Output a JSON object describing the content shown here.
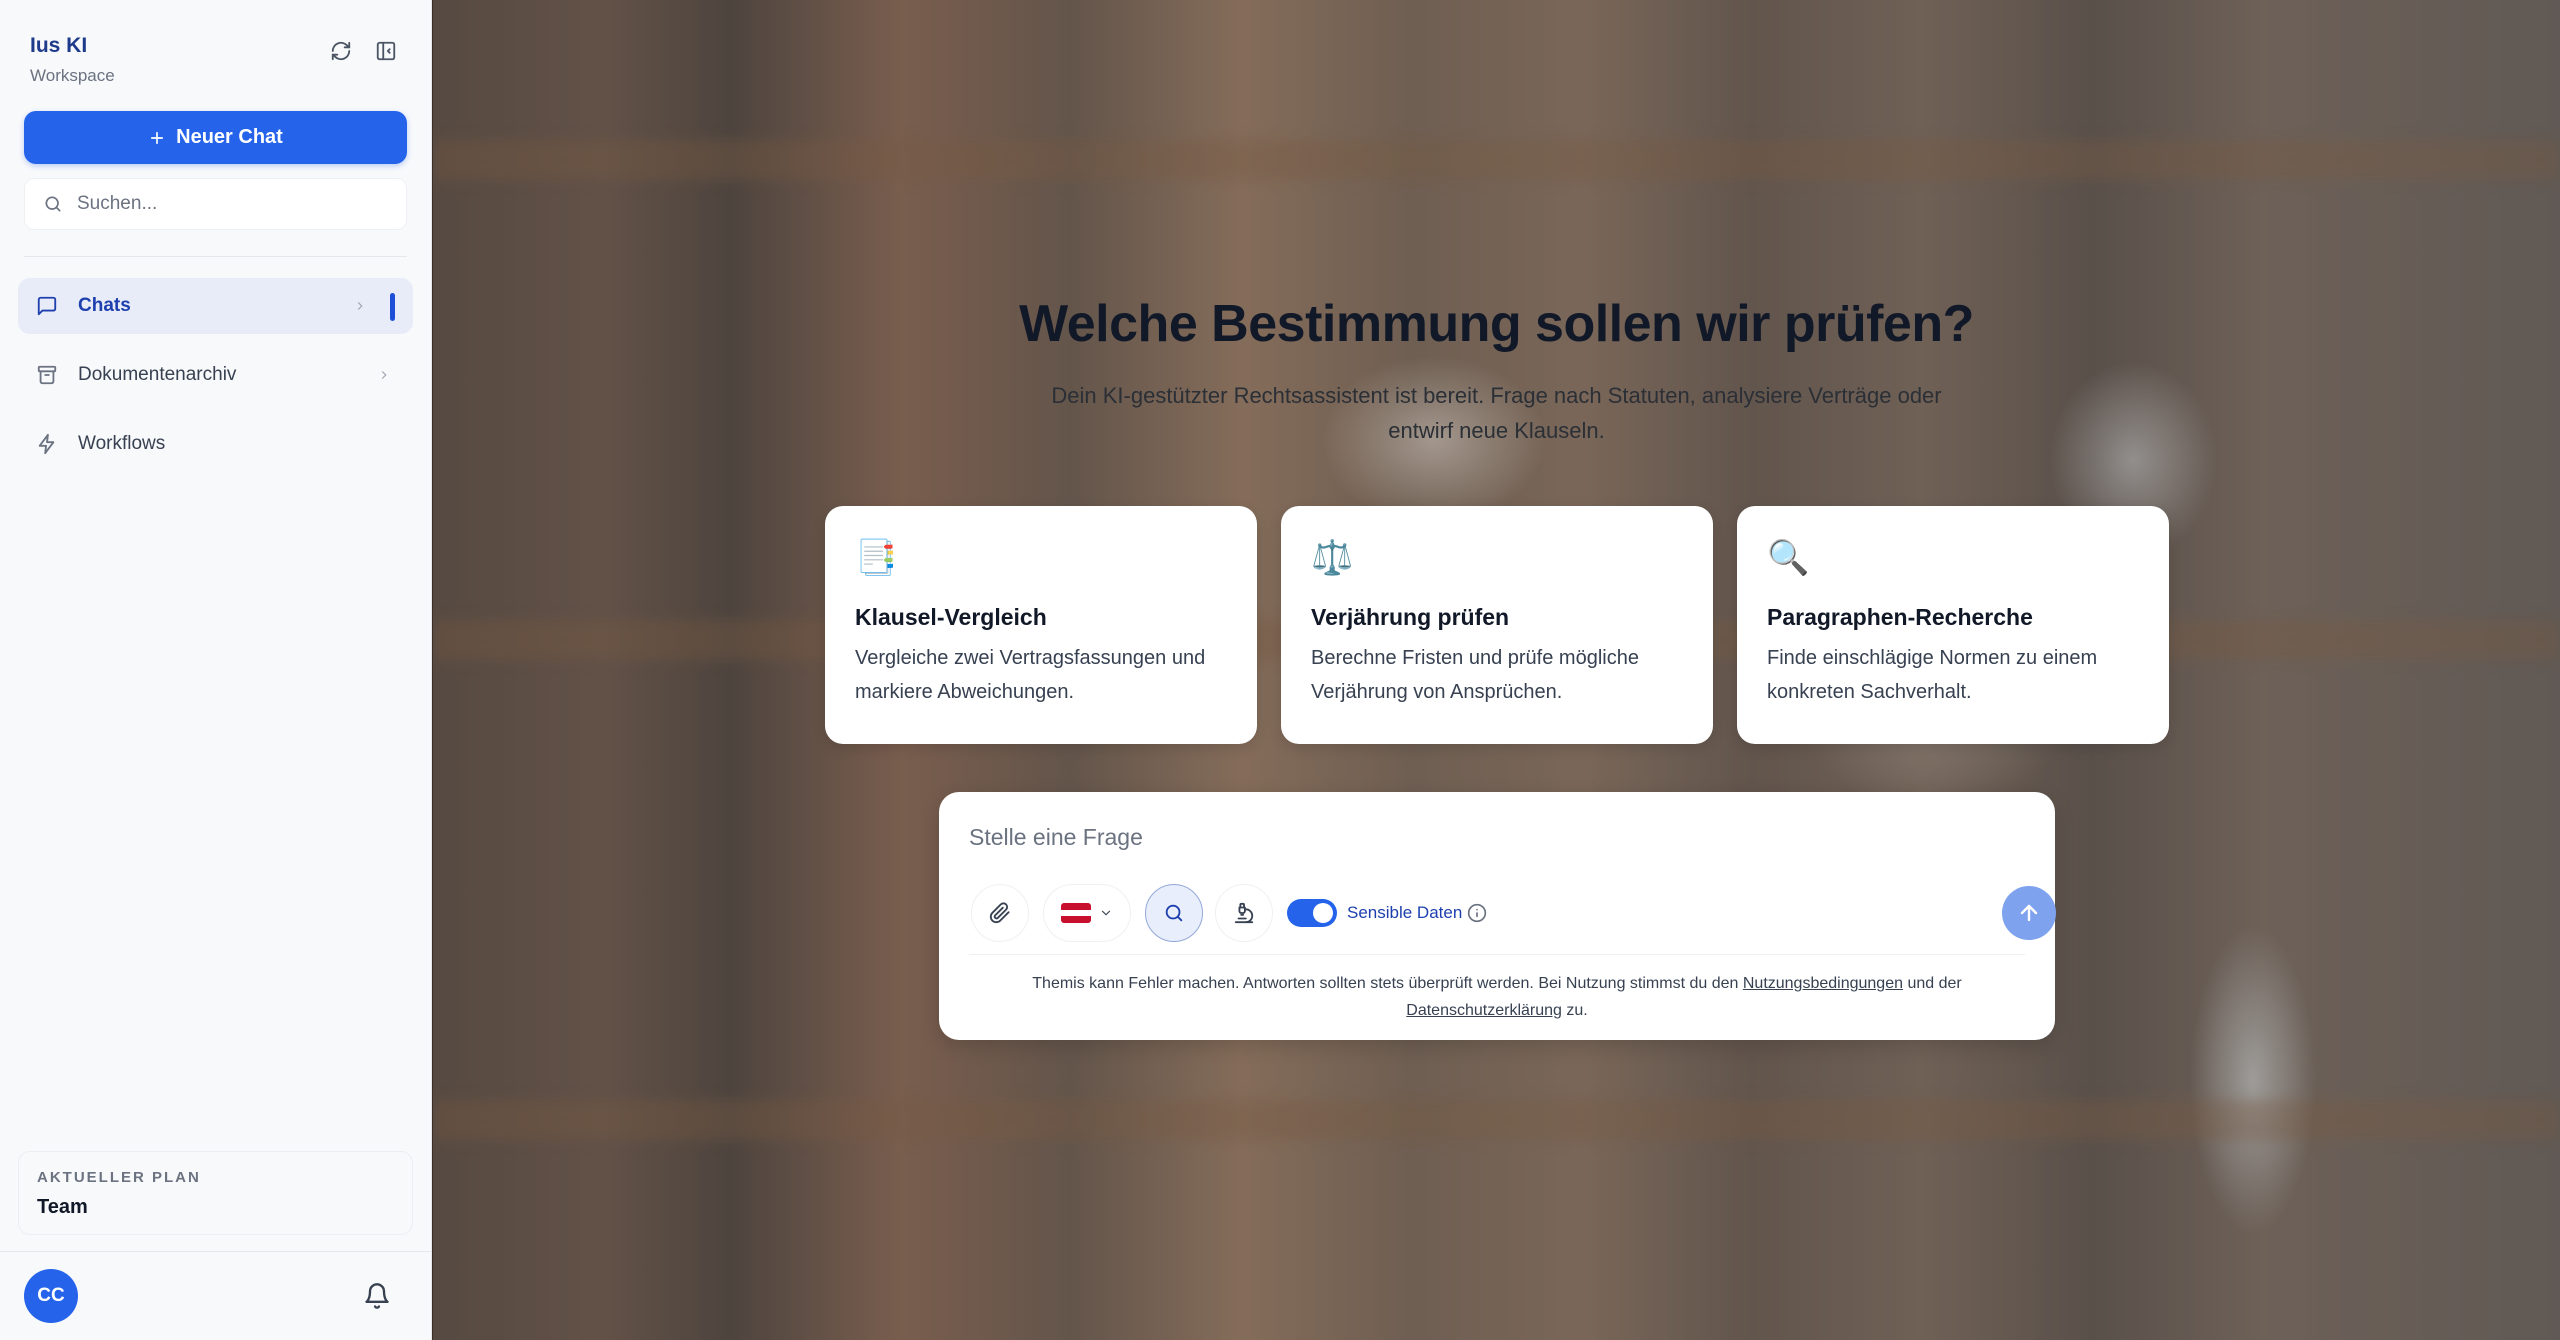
{
  "brand": {
    "title": "Ius KI",
    "subtitle": "Workspace"
  },
  "sidebar": {
    "new_chat_label": "Neuer Chat",
    "search_placeholder": "Suchen...",
    "items": [
      {
        "label": "Chats",
        "icon": "message-square-icon",
        "active": true
      },
      {
        "label": "Dokumentenarchiv",
        "icon": "archive-icon",
        "active": false
      },
      {
        "label": "Workflows",
        "icon": "lightning-icon",
        "active": false
      }
    ],
    "plan": {
      "label": "AKTUELLER PLAN",
      "name": "Team"
    },
    "avatar_initials": "CC"
  },
  "hero": {
    "title": "Welche Bestimmung sollen wir prüfen?",
    "subtitle": "Dein KI-gestützter Rechtsassistent ist bereit. Frage nach Statuten, analysiere Verträge oder entwirf neue Klauseln."
  },
  "cards": [
    {
      "emoji": "📑",
      "title": "Klausel-Vergleich",
      "desc": "Vergleiche zwei Vertragsfassungen und markiere Abweichungen."
    },
    {
      "emoji": "⚖️",
      "title": "Verjährung prüfen",
      "desc": "Berechne Fristen und prüfe mögliche Verjährung von Ansprüchen."
    },
    {
      "emoji": "🔍",
      "title": "Paragraphen-Recherche",
      "desc": "Finde einschlägige Normen zu einem konkreten Sachverhalt."
    }
  ],
  "composer": {
    "placeholder": "Stelle eine Frage",
    "sensitive_label": "Sensible Daten",
    "disclaimer_pre": "Themis kann Fehler machen. Antworten sollten stets überprüft werden. Bei Nutzung stimmst du den ",
    "terms_link": "Nutzungsbedingungen",
    "disclaimer_mid": " und der ",
    "privacy_link": "Datenschutzerklärung",
    "disclaimer_post": " zu."
  },
  "colors": {
    "accent": "#2563eb",
    "send_disabled": "#7fa2ee",
    "flag_red": "#c8102e"
  }
}
